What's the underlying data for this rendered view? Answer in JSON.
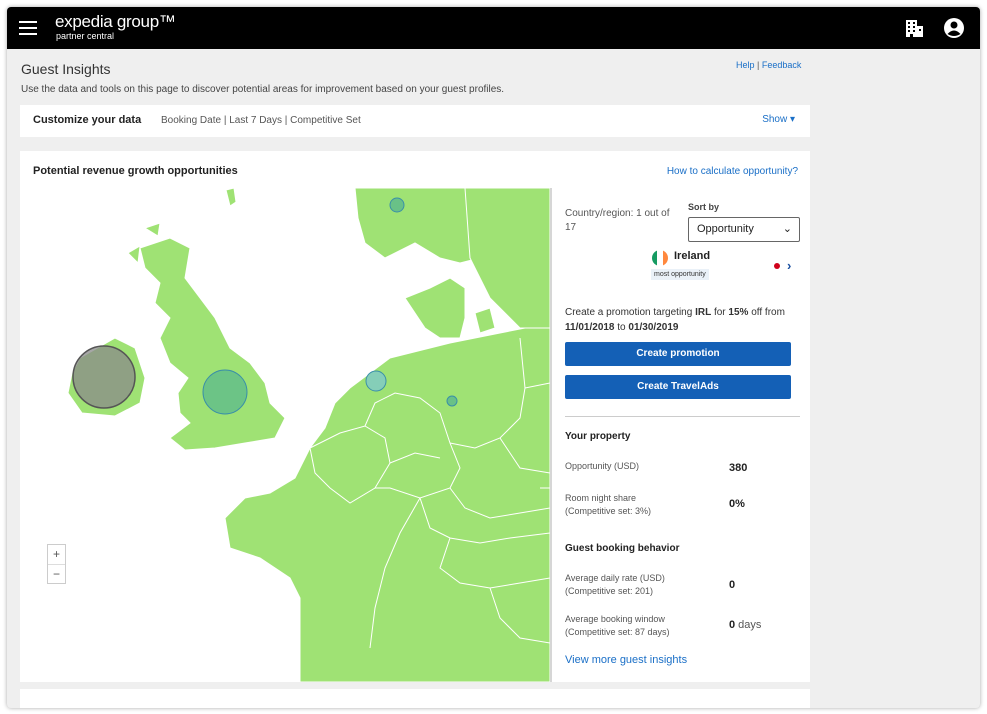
{
  "colors": {
    "topbar": "#000000",
    "accent": "#1460b6",
    "link": "#1a6fc7",
    "map_land": "#9fe274",
    "flag_green": "#169b62",
    "flag_orange": "#ff883e"
  },
  "header": {
    "logo_main": "expedia group™",
    "logo_sub": "partner central",
    "icons": [
      "menu-icon",
      "building-icon",
      "account-icon"
    ]
  },
  "page": {
    "title": "Guest Insights",
    "description": "Use the data and tools on this page to discover potential areas for improvement based on your guest profiles.",
    "help": "Help",
    "separator": "|",
    "feedback": "Feedback"
  },
  "customize": {
    "title": "Customize your data",
    "filters": "Booking Date | Last 7 Days | Competitive Set",
    "show": "Show ▾"
  },
  "revenue": {
    "title": "Potential revenue growth opportunities",
    "how_link": "How to calculate opportunity?",
    "zoom_in": "+",
    "zoom_out": "−"
  },
  "panel": {
    "country_count": "Country/region: 1 out of 17",
    "sort_label": "Sort by",
    "sort_value": "Opportunity",
    "country": "Ireland",
    "badge": "most opportunity",
    "promo_prefix": "Create a promotion targeting ",
    "promo_code": "IRL",
    "promo_mid": " for ",
    "promo_pct": "15%",
    "promo_mid2": " off from ",
    "promo_from": "11/01/2018",
    "promo_to_word": " to ",
    "promo_to": "01/30/2019",
    "btn_promotion": "Create promotion",
    "btn_travelads": "Create TravelAds",
    "your_property": "Your property",
    "opportunity_label": "Opportunity (USD)",
    "opportunity_value": "380",
    "room_share_label": "Room night share",
    "room_share_sub": "(Competitive set: 3%)",
    "room_share_value": "0%",
    "guest_behavior": "Guest booking behavior",
    "adr_label": "Average daily rate (USD)",
    "adr_sub": "(Competitive set: 201)",
    "adr_value": "0",
    "window_label": "Average booking window",
    "window_sub": "(Competitive set: 87 days)",
    "window_value": "0",
    "window_unit": " days",
    "more_link": "View more guest insights"
  }
}
